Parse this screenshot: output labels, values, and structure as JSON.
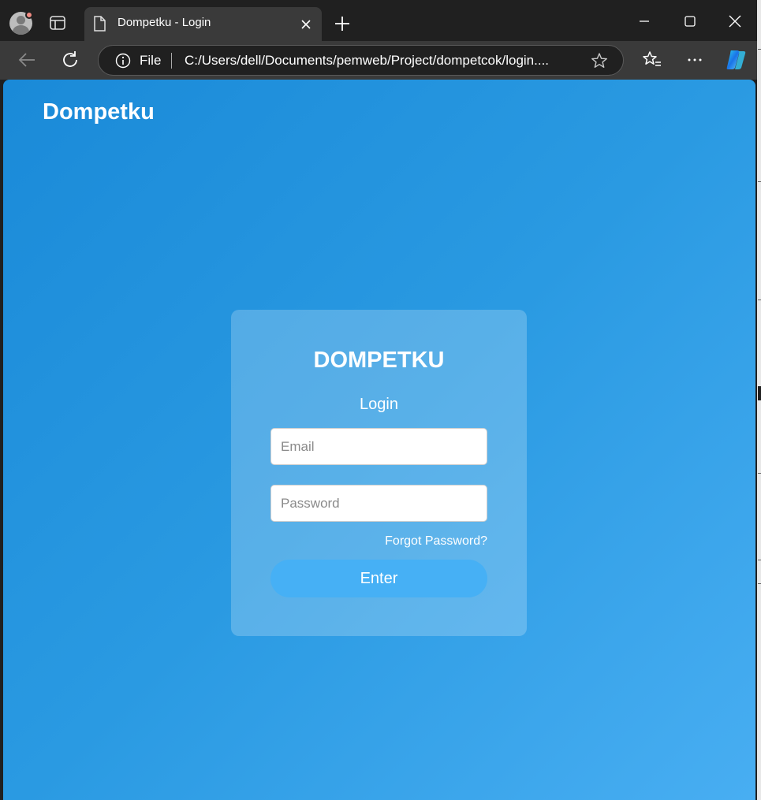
{
  "browser": {
    "tab_title": "Dompetku - Login",
    "address_prefix": "File",
    "url": "C:/Users/dell/Documents/pemweb/Project/dompetcok/login...."
  },
  "page": {
    "brand": "Dompetku",
    "card_title": "DOMPETKU",
    "card_subtitle": "Login",
    "email_placeholder": "Email",
    "password_placeholder": "Password",
    "forgot_link": "Forgot Password?",
    "enter_label": "Enter"
  },
  "colors": {
    "background_start": "#1a8ad8",
    "background_end": "#48aef2",
    "button": "#46b0f5"
  }
}
